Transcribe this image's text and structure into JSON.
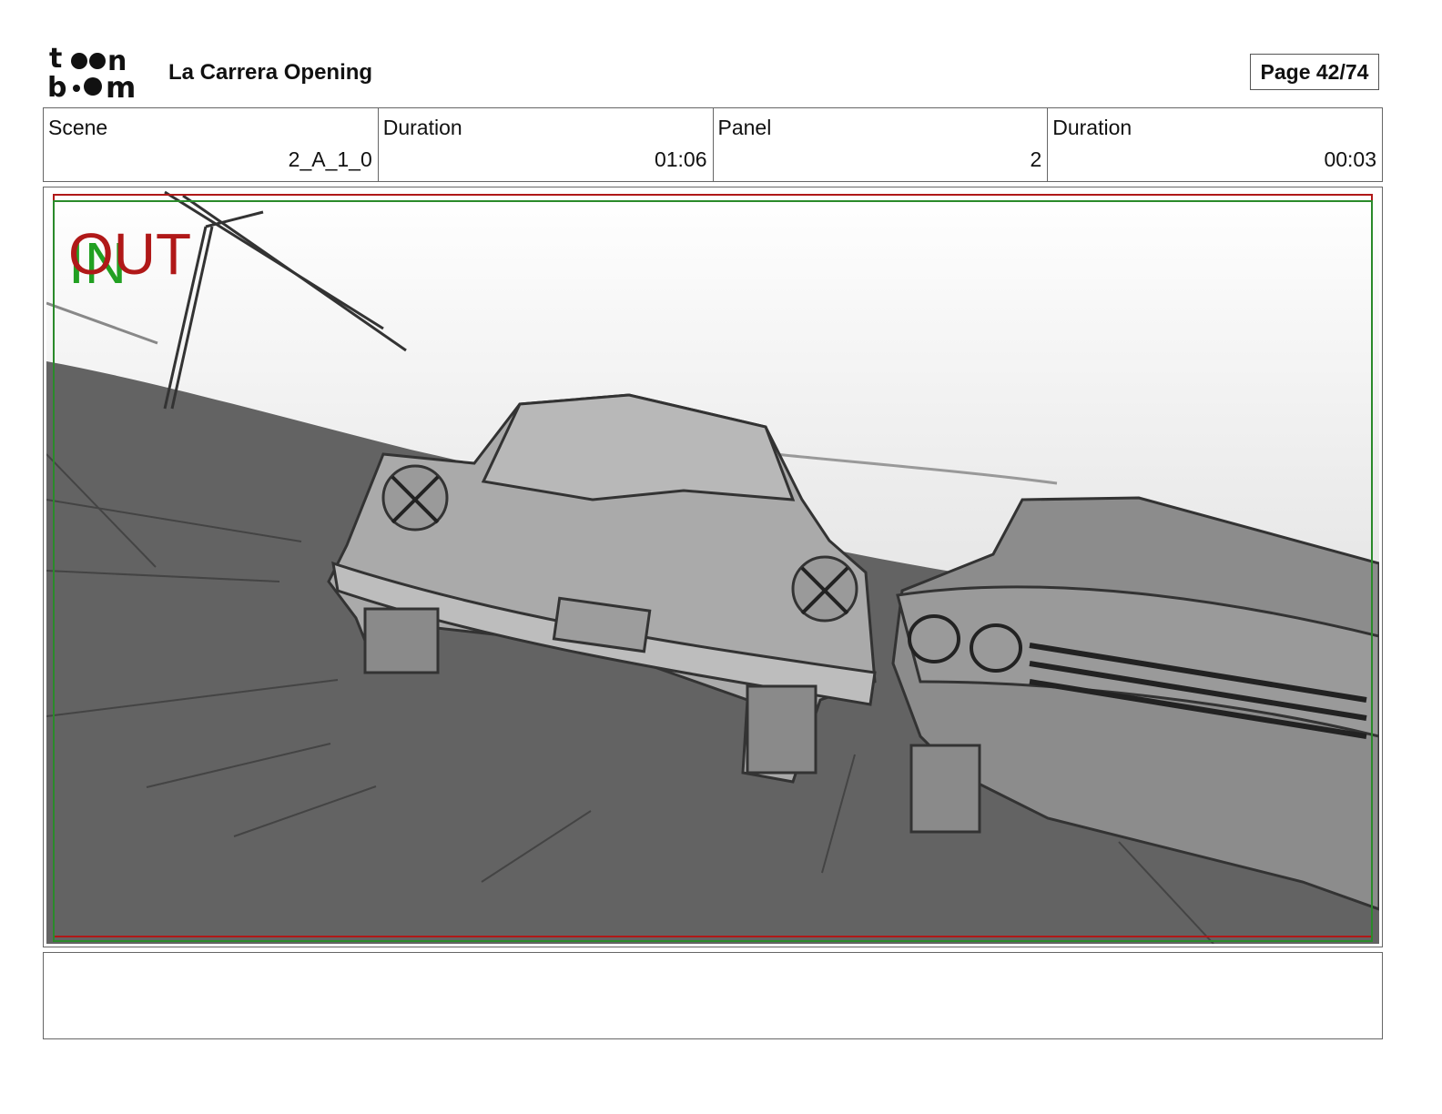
{
  "header": {
    "logo_text": "toon boom",
    "project_title": "La Carrera Opening",
    "page_label": "Page 42/74"
  },
  "info": [
    {
      "label": "Scene",
      "value": "2_A_1_0"
    },
    {
      "label": "Duration",
      "value": "01:06"
    },
    {
      "label": "Panel",
      "value": "2"
    },
    {
      "label": "Duration",
      "value": "00:03"
    }
  ],
  "panel": {
    "in_marker": "IN",
    "out_marker": "OUT",
    "in_color": "#22a022",
    "out_color": "#b01818",
    "safe_frame_red": "#b01818",
    "safe_frame_green": "#2a8a2a"
  },
  "notes": {
    "text": ""
  }
}
